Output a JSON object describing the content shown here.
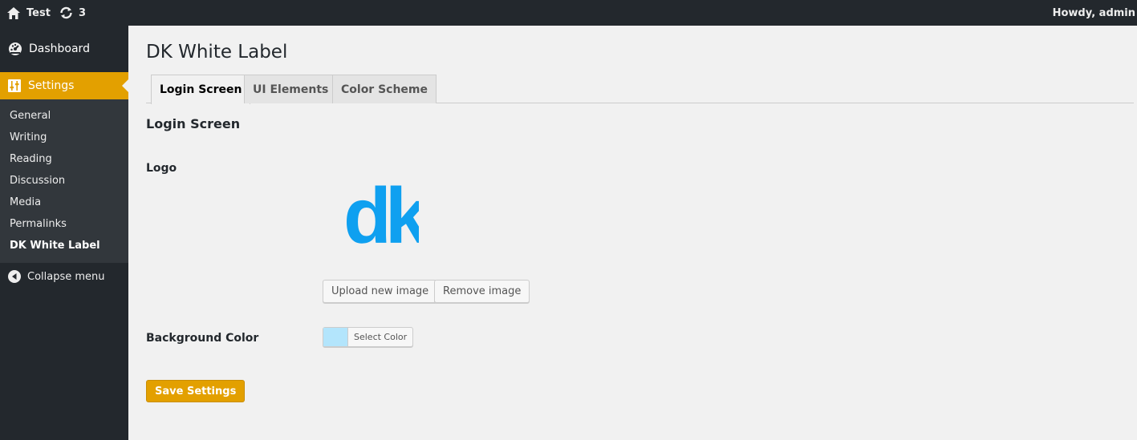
{
  "admin_bar": {
    "site_name": "Test",
    "updates_count": "3",
    "howdy": "Howdy, admin"
  },
  "sidebar": {
    "dashboard_label": "Dashboard",
    "settings_label": "Settings",
    "submenu": [
      "General",
      "Writing",
      "Reading",
      "Discussion",
      "Media",
      "Permalinks",
      "DK White Label"
    ],
    "collapse_label": "Collapse menu"
  },
  "page": {
    "title": "DK White Label",
    "tabs": [
      "Login Screen",
      "UI Elements",
      "Color Scheme"
    ],
    "active_tab": "Login Screen",
    "section_title": "Login Screen",
    "logo_label": "Logo",
    "logo_text": "dk",
    "upload_button": "Upload new image",
    "remove_button": "Remove image",
    "bg_color_label": "Background Color",
    "select_color_button": "Select Color",
    "save_button": "Save Settings"
  },
  "colors": {
    "accent": "#e3a000",
    "admin_dark": "#23282d",
    "logo_blue": "#0fa0f0",
    "bg_swatch": "#b3e5fc"
  }
}
